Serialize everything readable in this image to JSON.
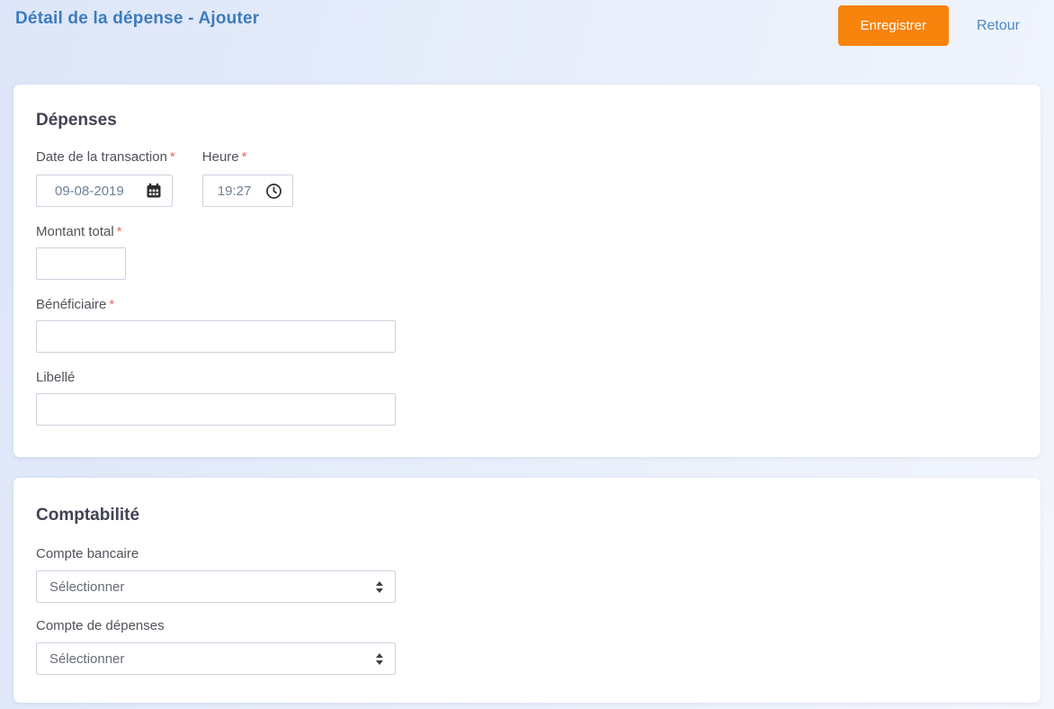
{
  "header": {
    "title": "Détail de la dépense - Ajouter",
    "save_button": "Enregistrer",
    "back_link": "Retour"
  },
  "expenses": {
    "section_title": "Dépenses",
    "date": {
      "label": "Date de la transaction",
      "required_mark": "*",
      "value": "09-08-2019"
    },
    "time": {
      "label": "Heure",
      "required_mark": "*",
      "value": "19:27"
    },
    "amount": {
      "label": "Montant total",
      "required_mark": "*",
      "value": ""
    },
    "beneficiary": {
      "label": "Bénéficiaire",
      "required_mark": "*",
      "value": ""
    },
    "libelle": {
      "label": "Libellé",
      "value": ""
    }
  },
  "accounting": {
    "section_title": "Comptabilité",
    "bank_account": {
      "label": "Compte bancaire",
      "selected_option": "Sélectionner"
    },
    "expense_account": {
      "label": "Compte de dépenses",
      "selected_option": "Sélectionner"
    }
  },
  "colors": {
    "accent_orange": "#F8830D",
    "title_blue": "#3D7CBE",
    "link_blue": "#4A87C7",
    "required_red": "#F06362",
    "card_white": "#FFFFFF",
    "input_border": "#CCD3DE",
    "background_start": "#DDE6F8",
    "background_end": "#F3F6FD"
  },
  "icons": {
    "calendar": "calendar-icon (dark filled calendar glyph)",
    "clock": "clock-icon (outlined clock glyph)",
    "select_arrows": "select-spinner-icon (up/down triangles)"
  }
}
